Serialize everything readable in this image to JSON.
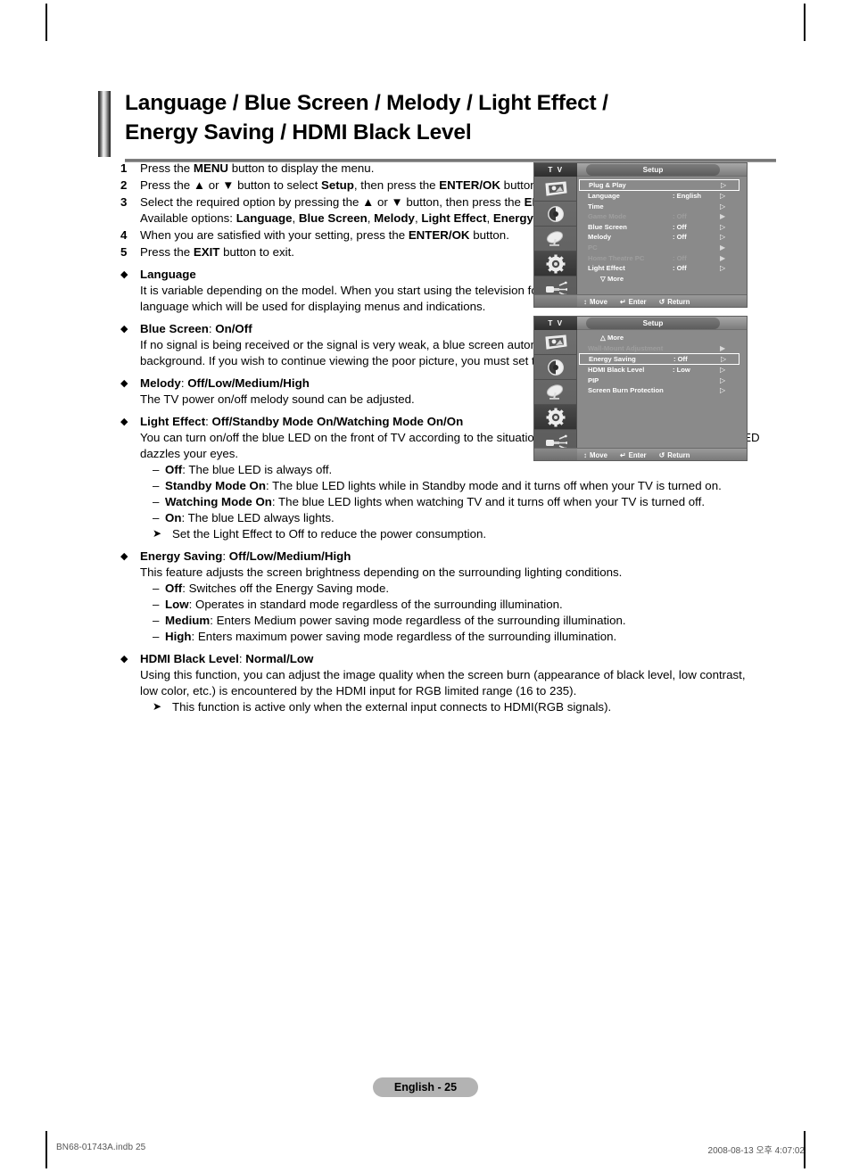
{
  "page": {
    "title_line1": "Language / Blue Screen / Melody / Light Effect /",
    "title_line2": "Energy Saving / HDMI Black Level",
    "page_label": "English - 25",
    "footer_left": "BN68-01743A.indb   25",
    "footer_right": "2008-08-13   오후 4:07:02"
  },
  "steps": [
    {
      "num": "1",
      "html": "Press the <b>MENU</b> button to display the menu."
    },
    {
      "num": "2",
      "html": "Press the ▲ or ▼ button to select <b>Setup</b>, then press the <b>ENTER/OK</b> button."
    },
    {
      "num": "3",
      "html": "Select the required option by pressing the ▲ or ▼ button, then press the <b>ENTER/OK</b> button.<br>Available options: <b>Language</b>, <b>Blue Screen</b>, <b>Melody</b>, <b>Light Effect</b>, <b>Energy Saving</b>, <b>HDMI Black Level</b>"
    },
    {
      "num": "4",
      "html": "When you are satisfied with your setting, press the <b>ENTER/OK</b> button."
    },
    {
      "num": "5",
      "html": "Press the <b>EXIT</b> button to exit."
    }
  ],
  "bullets": [
    {
      "head": "Language",
      "head_suffix": "",
      "body": "It is variable depending on the model. When you start using the television for the first time, you must select the language which will be used for displaying menus and indications.",
      "width": "narrow",
      "items": [],
      "note": ""
    },
    {
      "head": "Blue Screen",
      "head_suffix": ": On/Off",
      "body": "If no signal is being received or the signal is very weak, a blue screen automatically replaces the noisy picture background. If you wish to continue viewing the poor picture, you must set the Blue Screen to Off.",
      "width": "narrow",
      "items": [],
      "note": ""
    },
    {
      "head": "Melody",
      "head_suffix": ": Off/Low/Medium/High",
      "body": "The TV power on/off melody sound can be adjusted.",
      "width": "wide",
      "items": [],
      "note": ""
    },
    {
      "head": "Light Effect",
      "head_suffix": ": Off/Standby Mode On/Watching Mode On/On",
      "body": "You can turn on/off the blue LED on the front of TV according to the situation. Use it for saving power or when the LED dazzles your eyes.",
      "width": "wide",
      "items": [
        {
          "term": "Off",
          "desc": ": The blue LED is always off."
        },
        {
          "term": "Standby Mode On",
          "desc": ": The blue LED lights while in Standby mode and it turns off when your TV is turned on."
        },
        {
          "term": "Watching Mode On",
          "desc": ": The blue LED lights when watching TV and it turns off when your TV is turned off."
        },
        {
          "term": "On",
          "desc": ": The blue LED always lights."
        }
      ],
      "note": "Set the Light Effect to Off to reduce the power consumption."
    },
    {
      "head": "Energy Saving",
      "head_suffix": ": Off/Low/Medium/High",
      "body": "This feature adjusts the screen brightness depending on the surrounding lighting conditions.",
      "width": "wide",
      "items": [
        {
          "term": "Off",
          "desc": ": Switches off the Energy Saving mode."
        },
        {
          "term": "Low",
          "desc": ": Operates in standard mode regardless of the surrounding illumination."
        },
        {
          "term": "Medium",
          "desc": ": Enters Medium power saving mode regardless of the surrounding illumination."
        },
        {
          "term": "High",
          "desc": ": Enters maximum power saving mode regardless of the surrounding illumination."
        }
      ],
      "note": ""
    },
    {
      "head": "HDMI Black Level",
      "head_suffix": ": Normal/Low",
      "body": "Using this function, you can adjust the image quality when the screen burn (appearance of black level, low contrast, low color, etc.) is encountered by the HDMI input for RGB limited range (16 to 235).",
      "width": "wide",
      "items": [],
      "note": "This function is active only when the external input connects to HDMI(RGB signals)."
    }
  ],
  "osd": {
    "source_label": "T V",
    "menu_title": "Setup",
    "sidebar_icons": [
      "picture-icon",
      "sound-icon",
      "channel-icon",
      "setup-icon",
      "input-icon"
    ],
    "selected_sidebar_index": 3,
    "footer": [
      {
        "glyph": "↕",
        "label": "Move",
        "icon": "updown-arrows-icon"
      },
      {
        "glyph": "↵",
        "label": "Enter",
        "icon": "enter-key-icon"
      },
      {
        "glyph": "↺",
        "label": "Return",
        "icon": "return-arrow-icon"
      }
    ],
    "screen1": {
      "rows": [
        {
          "label": "Plug & Play",
          "value": "",
          "arrow": "▷",
          "dim": false,
          "selected": true
        },
        {
          "label": "Language",
          "value": ": English",
          "arrow": "▷",
          "dim": false,
          "selected": false
        },
        {
          "label": "Time",
          "value": "",
          "arrow": "▷",
          "dim": false,
          "selected": false
        },
        {
          "label": "Game Mode",
          "value": ": Off",
          "arrow": "▶",
          "dim": true,
          "selected": false
        },
        {
          "label": "Blue Screen",
          "value": ": Off",
          "arrow": "▷",
          "dim": false,
          "selected": false
        },
        {
          "label": "Melody",
          "value": ": Off",
          "arrow": "▷",
          "dim": false,
          "selected": false
        },
        {
          "label": "PC",
          "value": "",
          "arrow": "▶",
          "dim": true,
          "selected": false
        },
        {
          "label": "Home Theatre PC",
          "value": ": Off",
          "arrow": "▶",
          "dim": true,
          "selected": false
        },
        {
          "label": "Light Effect",
          "value": ": Off",
          "arrow": "▷",
          "dim": false,
          "selected": false
        }
      ],
      "more_label": "▽  More"
    },
    "screen2": {
      "more_label": "△  More",
      "rows": [
        {
          "label": "Wall-Mount Adjustment",
          "value": "",
          "arrow": "▶",
          "dim": true,
          "selected": false
        },
        {
          "label": "Energy Saving",
          "value": ": Off",
          "arrow": "▷",
          "dim": false,
          "selected": true
        },
        {
          "label": "HDMI Black Level",
          "value": ": Low",
          "arrow": "▷",
          "dim": false,
          "selected": false
        },
        {
          "label": "PIP",
          "value": "",
          "arrow": "▷",
          "dim": false,
          "selected": false
        },
        {
          "label": "Screen Burn Protection",
          "value": "",
          "arrow": "▷",
          "dim": false,
          "selected": false
        }
      ]
    }
  },
  "colors": {
    "osd_bg": "#8a8a8a",
    "osd_sidebar": "#6f6f6f",
    "osd_dim_text": "#9e9e9e",
    "page_pill_bg": "#b3b3b3"
  }
}
